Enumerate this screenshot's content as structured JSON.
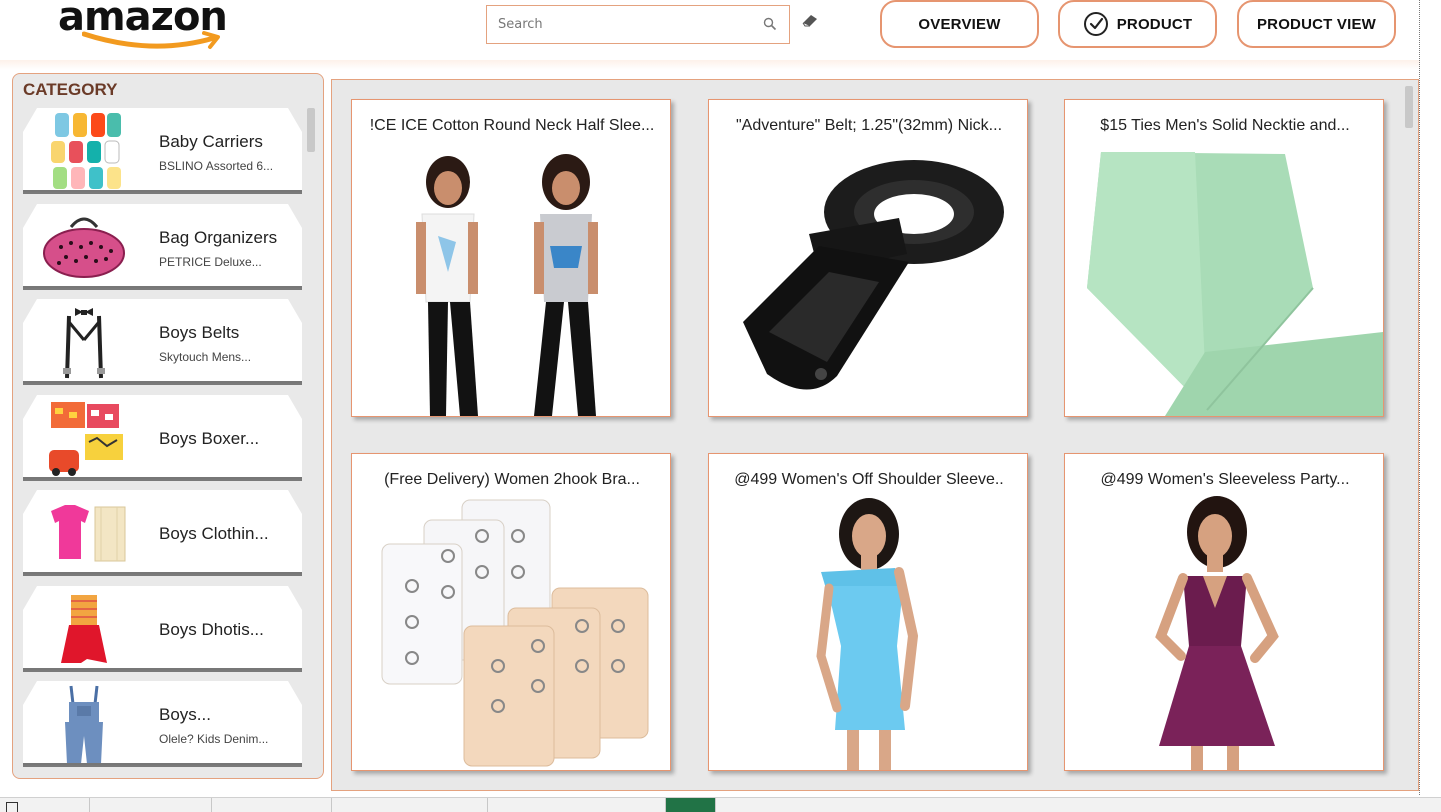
{
  "header": {
    "logo_text": "amazon",
    "search": {
      "placeholder": "Search",
      "value": ""
    },
    "nav": {
      "overview": "OVERVIEW",
      "product": "PRODUCT",
      "product_view": "PRODUCT VIEW"
    }
  },
  "category": {
    "title": "CATEGORY",
    "items": [
      {
        "label": "Baby Carriers",
        "sub": "BSLINO Assorted 6..."
      },
      {
        "label": "Bag Organizers",
        "sub": "PETRICE Deluxe..."
      },
      {
        "label": "Boys Belts",
        "sub": "Skytouch Mens..."
      },
      {
        "label": "Boys Boxer...",
        "sub": ""
      },
      {
        "label": "Boys Clothin...",
        "sub": ""
      },
      {
        "label": "Boys Dhotis...",
        "sub": ""
      },
      {
        "label": "Boys...",
        "sub": "Olele? Kids Denim..."
      }
    ]
  },
  "products": [
    {
      "title": "!CE ICE Cotton Round Neck Half Slee..."
    },
    {
      "title": "\"Adventure\" Belt; 1.25\"(32mm) Nick..."
    },
    {
      "title": "$15 Ties Men's Solid Necktie and..."
    },
    {
      "title": "(Free Delivery) Women 2hook Bra..."
    },
    {
      "title": "@499 Women's Off Shoulder Sleeve.."
    },
    {
      "title": "@499 Women's Sleeveless Party..."
    }
  ],
  "colors": {
    "accent_border": "#e69570",
    "category_title": "#6b3b28",
    "active_sheet_tab": "#217346"
  }
}
